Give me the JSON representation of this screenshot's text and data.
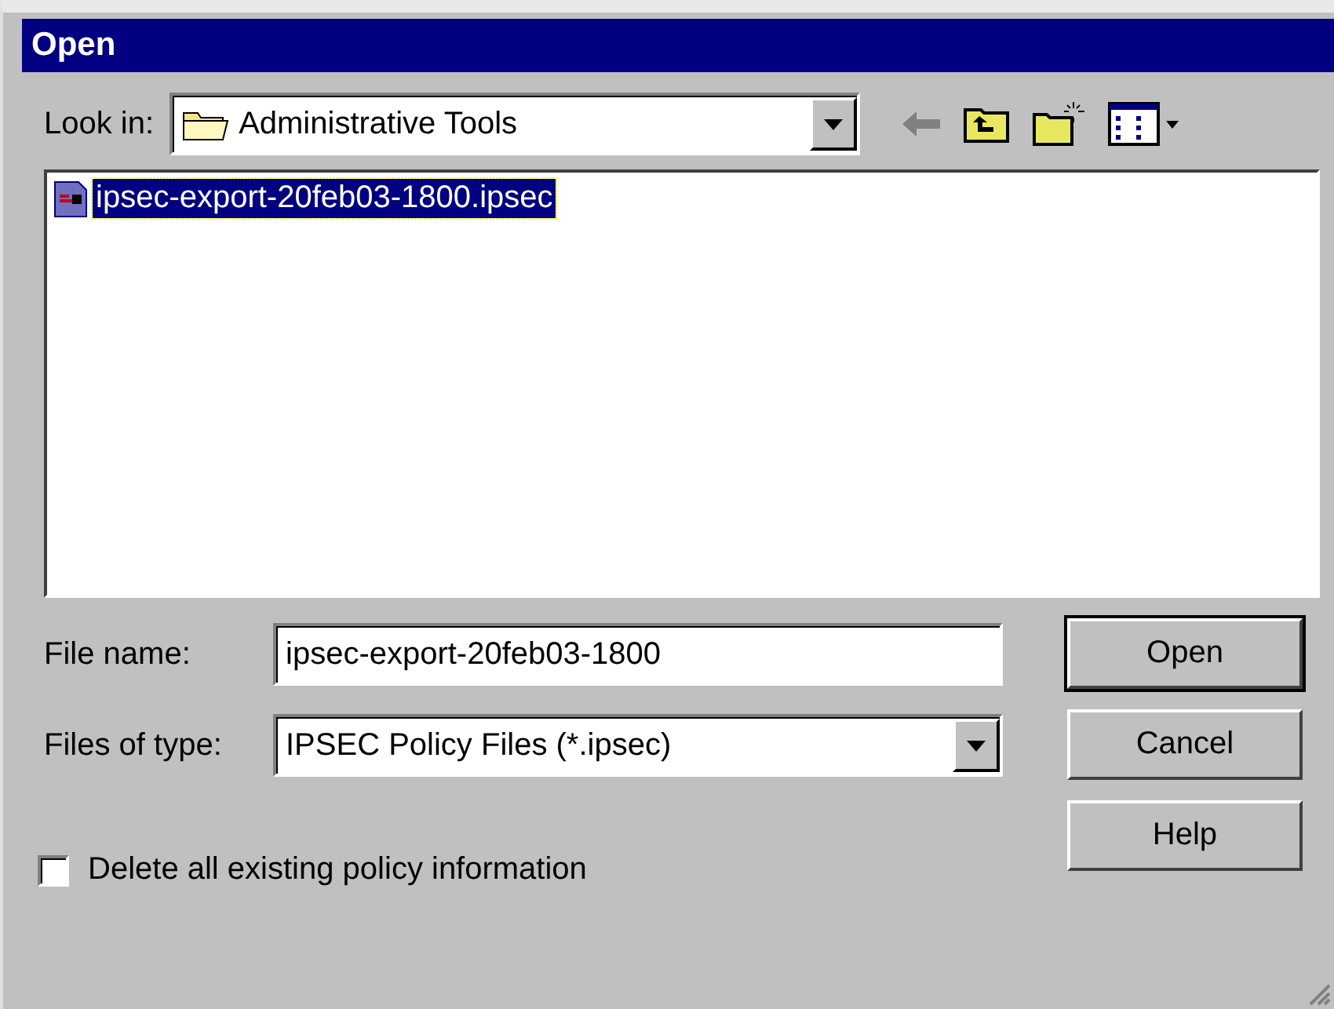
{
  "window": {
    "title": "Open"
  },
  "look_in": {
    "label": "Look in:",
    "value": "Administrative Tools"
  },
  "files": [
    {
      "name": "ipsec-export-20feb03-1800.ipsec",
      "selected": true
    }
  ],
  "file_name": {
    "label": "File name:",
    "value": "ipsec-export-20feb03-1800"
  },
  "file_type": {
    "label": "Files of type:",
    "value": "IPSEC Policy Files (*.ipsec)"
  },
  "buttons": [
    {
      "label": "Open",
      "default": true
    },
    {
      "label": "Cancel",
      "default": false
    },
    {
      "label": "Help",
      "default": false
    }
  ],
  "delete_option": {
    "label": "Delete all existing policy information",
    "checked": false
  }
}
